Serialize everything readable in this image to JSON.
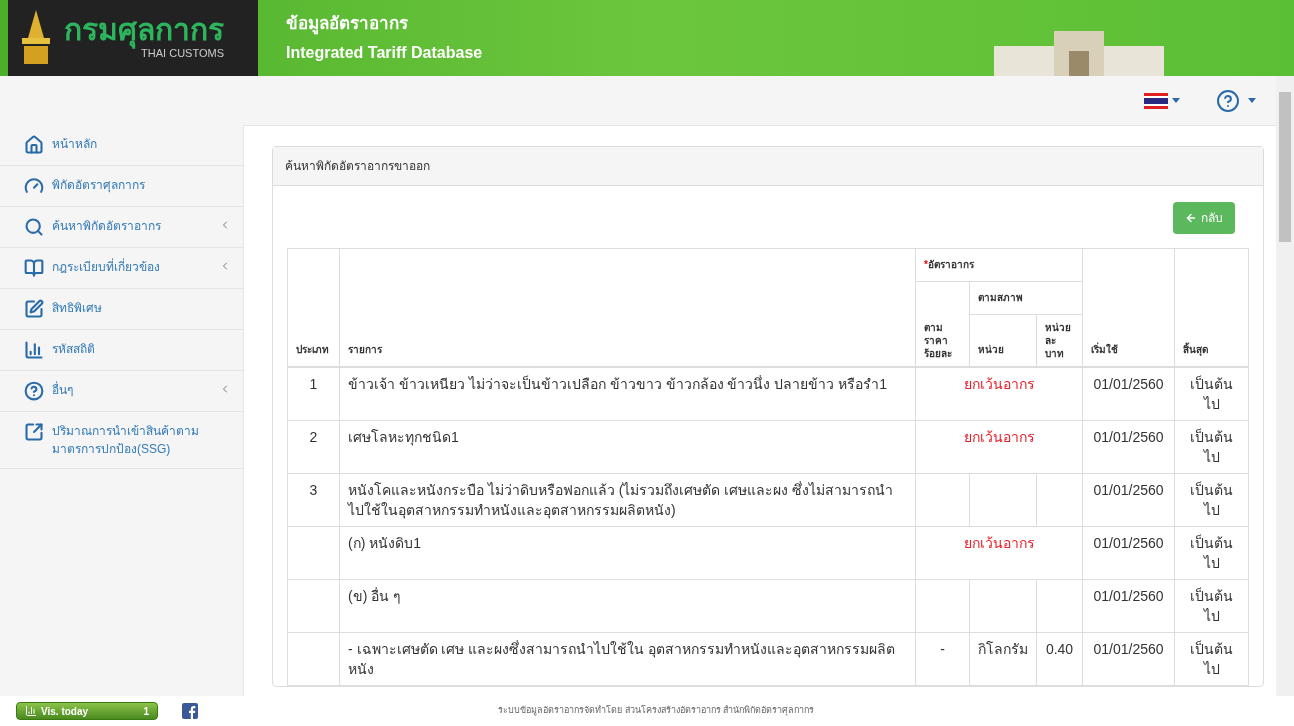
{
  "header": {
    "logo_thai": "กรมศุลกากร",
    "logo_english": "THAI CUSTOMS",
    "title": "ข้อมูลอัตราอากร",
    "subtitle": "Integrated Tariff Database"
  },
  "sidebar": {
    "items": [
      {
        "label": "หน้าหลัก",
        "has_submenu": false
      },
      {
        "label": "พิกัดอัตราศุลกากร",
        "has_submenu": false
      },
      {
        "label": "ค้นหาพิกัดอัตราอากร",
        "has_submenu": true
      },
      {
        "label": "กฎระเบียบที่เกี่ยวข้อง",
        "has_submenu": true
      },
      {
        "label": "สิทธิพิเศษ",
        "has_submenu": false
      },
      {
        "label": "รหัสสถิติ",
        "has_submenu": false
      },
      {
        "label": "อื่นๆ",
        "has_submenu": true
      },
      {
        "label": "ปริมาณการนำเข้าสินค้าตามมาตรการปกป้อง(SSG)",
        "has_submenu": false
      }
    ]
  },
  "panel": {
    "title": "ค้นหาพิกัดอัตราอากรขาออก",
    "back_button": "กลับ"
  },
  "table": {
    "columns": {
      "type": "ประเภท",
      "description": "รายการ",
      "duty_group": "อัตราอากร",
      "duty_required_mark": "*",
      "ad_valorem": "ตาม ราคา ร้อยละ",
      "specific_group": "ตามสภาพ",
      "unit": "หน่วย",
      "per_unit": "หน่วย ละ บาท",
      "start": "เริ่มใช้",
      "end": "สิ้นสุด"
    },
    "rows": [
      {
        "kind": "exempt",
        "type": "1",
        "description": "ข้าวเจ้า ข้าวเหนียว ไม่ว่าจะเป็นข้าวเปลือก ข้าวขาว ข้าวกล้อง ข้าวนึ่ง ปลายข้าว หรือรำ1",
        "duty": "ยกเว้นอากร",
        "start": "01/01/2560",
        "end": "เป็นต้น ไป"
      },
      {
        "kind": "exempt",
        "type": "2",
        "description": "เศษโลหะทุกชนิด1",
        "duty": "ยกเว้นอากร",
        "start": "01/01/2560",
        "end": "เป็นต้น ไป"
      },
      {
        "kind": "rates",
        "type": "3",
        "description": "หนังโคและหนังกระบือ ไม่ว่าดิบหรือฟอกแล้ว (ไม่รวมถึงเศษตัด เศษและผง ซึ่งไม่สามารถนำไปใช้ในอุตสาหกรรมทำหนังและอุตสาหกรรมผลิตหนัง)",
        "start": "01/01/2560",
        "end": "เป็นต้น ไป"
      },
      {
        "kind": "exempt",
        "description": "(ก) หนังดิบ1",
        "duty": "ยกเว้นอากร",
        "start": "01/01/2560",
        "end": "เป็นต้น ไป"
      },
      {
        "kind": "rates",
        "description": "(ข) อื่น ๆ",
        "start": "01/01/2560",
        "end": "เป็นต้น ไป"
      },
      {
        "kind": "rates",
        "description": "- เฉพาะเศษตัด เศษ และผงซึ่งสามารถนำไปใช้ใน อุตสาหกรรมทำหนังและอุตสาหกรรมผลิตหนัง",
        "ad_valorem": "-",
        "unit": "กิโลกรัม",
        "per_unit": "0.40",
        "start": "01/01/2560",
        "end": "เป็นต้น ไป"
      }
    ]
  },
  "footer": {
    "visitor_label": "Vis. today",
    "visitor_count": "1",
    "credit": "ระบบข้อมูลอัตราอากรจัดทำโดย ส่วนโครงสร้างอัตราอากร สำนักพิกัดอัตราศุลกากร"
  }
}
